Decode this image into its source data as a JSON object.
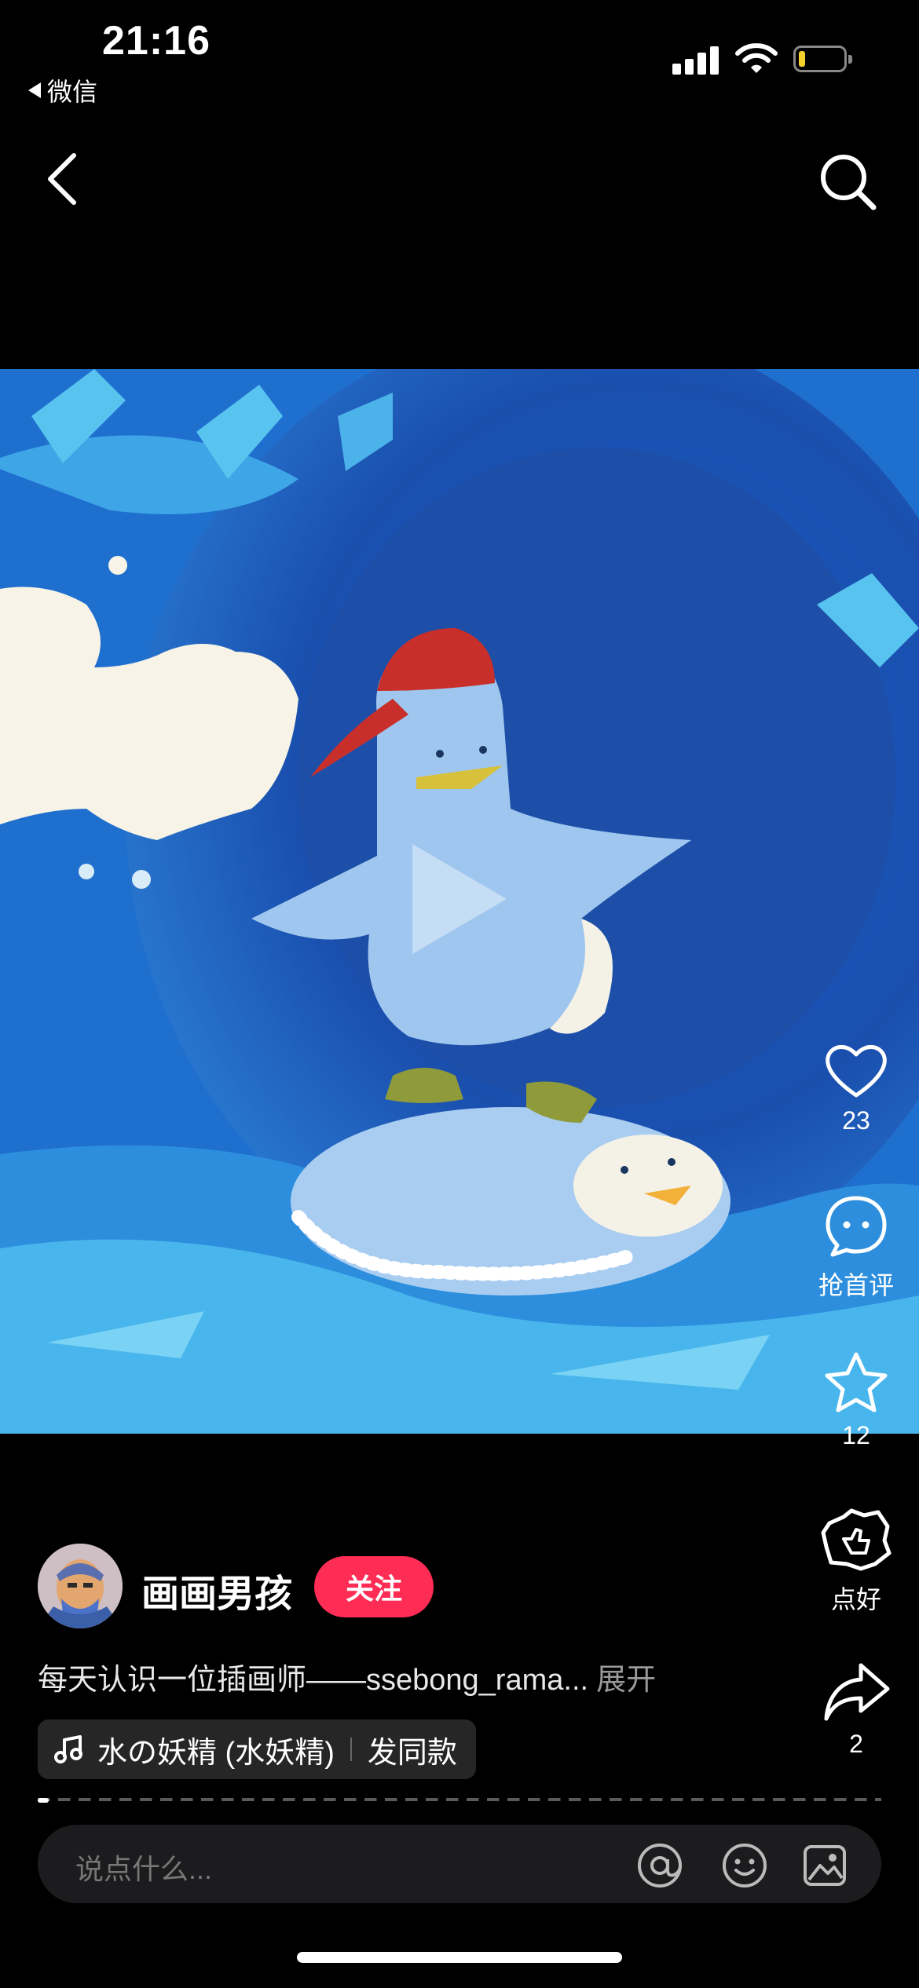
{
  "status_bar": {
    "time": "21:16",
    "back_app": "微信",
    "battery_color": "#f4d12c"
  },
  "nav": {
    "back_icon": "chevron-left-icon",
    "search_icon": "search-icon"
  },
  "media": {
    "type": "video",
    "play_icon": "play-icon"
  },
  "actions": {
    "like": {
      "icon": "heart-icon",
      "label": "23"
    },
    "comment": {
      "icon": "comment-bubble-icon",
      "label": "抢首评"
    },
    "collect": {
      "icon": "star-icon",
      "label": "12"
    },
    "recommend": {
      "icon": "thumbs-up-badge-icon",
      "label": "点好"
    },
    "share": {
      "icon": "share-arrow-icon",
      "label": "2"
    }
  },
  "author": {
    "name": "画画男孩",
    "follow_label": "关注"
  },
  "post": {
    "description": "每天认识一位插画师——ssebong_rama...",
    "expand_label": "展开"
  },
  "music": {
    "title": "水の妖精 (水妖精)",
    "use_label": "发同款"
  },
  "comment_bar": {
    "placeholder": "说点什么..."
  },
  "colors": {
    "accent": "#ff2d55",
    "background": "#000000"
  }
}
